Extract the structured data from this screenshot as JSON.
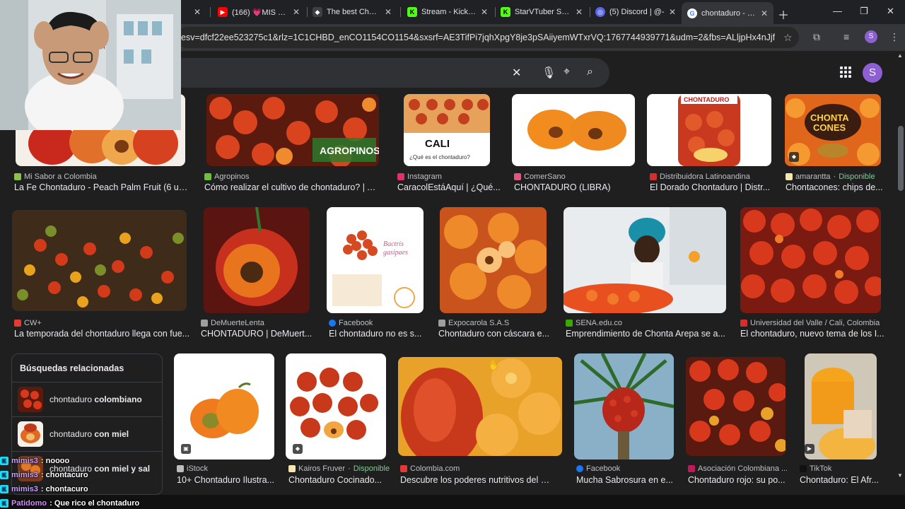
{
  "browser": {
    "tabs": [
      {
        "title": "e",
        "favicon": "tab-favicon",
        "color": "#5f6368"
      },
      {
        "title": "(166) 💗MIS PAPÁ...",
        "favicon": "youtube-icon",
        "color": "#ff0000"
      },
      {
        "title": "The best ChatBo",
        "favicon": "chatbot-icon",
        "color": "#e8eaed"
      },
      {
        "title": "Stream - Kick Da",
        "favicon": "kick-icon",
        "color": "#53fc18"
      },
      {
        "title": "StarVTuber Strea",
        "favicon": "kick-icon",
        "color": "#53fc18"
      },
      {
        "title": "(5) Discord | @-",
        "favicon": "discord-icon",
        "color": "#5865f2"
      },
      {
        "title": "chontaduro - Bu",
        "favicon": "google-icon",
        "color": "#ffffff"
      }
    ],
    "url": "esv=dfcf22ee523275c1&rlz=1C1CHBD_enCO1154CO1154&sxsrf=AE3TifPi7jqhXpgY8je3pSAiiyemWTxrVQ:1767744939771&udm=2&fbs=ALljpHx4nJjfGojPVHhEAC...",
    "profile_initial": "S"
  },
  "google": {
    "account_initial": "S"
  },
  "row1": [
    {
      "source": "Mi Sabor a Colombia",
      "title": "La Fe Chontaduro - Peach Palm Fruit (6 uni...",
      "fav": "#8bc34a"
    },
    {
      "source": "Agropinos",
      "title": "Cómo realizar el cultivo de chontaduro? | Ag...",
      "fav": "#6fbf3a"
    },
    {
      "source": "Instagram",
      "title": "CaracolEstáAquí | ¿Qué...",
      "fav": "#e1306c"
    },
    {
      "source": "ComerSano",
      "title": "CHONTADURO (LIBRA)",
      "fav": "#e05780"
    },
    {
      "source": "Distribuidora Latinoandina",
      "title": "El Dorado Chontaduro | Distr...",
      "fav": "#d32f2f"
    },
    {
      "source": "amarantta",
      "available": "Disponible",
      "title": "Chontacones: chips de...",
      "fav": "#f5e6b0"
    }
  ],
  "row2": [
    {
      "source": "CW+",
      "title": "La temporada del chontaduro llega con fue...",
      "fav": "#e53935"
    },
    {
      "source": "DeMuerteLenta",
      "title": "CHONTADURO | DeMuert...",
      "fav": "#9e9e9e"
    },
    {
      "source": "Facebook",
      "title": "El chontaduro no es s...",
      "fav": "#1877f2"
    },
    {
      "source": "Expocarola S.A.S",
      "title": "Chontaduro con cáscara e...",
      "fav": "#9e9e9e"
    },
    {
      "source": "SENA.edu.co",
      "title": "Emprendimiento de Chonta Arepa se a...",
      "fav": "#39a900"
    },
    {
      "source": "Universidad del Valle / Cali, Colombia",
      "title": "El chontaduro, nuevo tema de los I...",
      "fav": "#d32f2f"
    }
  ],
  "row3": [
    {
      "source": "iStock",
      "title": "10+ Chontaduro Ilustra...",
      "fav": "#bdbdbd"
    },
    {
      "source": "Kairos Fruver",
      "available": "Disponible",
      "title": "Chontaduro Cocinado...",
      "fav": "#f5e6b0"
    },
    {
      "source": "Colombia.com",
      "title": "Descubre los poderes nutritivos del Cho...",
      "fav": "#e53935"
    },
    {
      "source": "Facebook",
      "title": "Mucha Sabrosura en e...",
      "fav": "#1877f2"
    },
    {
      "source": "Asociación Colombiana ...",
      "title": "Chontaduro rojo: su po...",
      "fav": "#c2185b"
    },
    {
      "source": "TikTok",
      "title": "Chontaduro: El Afr...",
      "fav": "#111111"
    }
  ],
  "related": {
    "title": "Búsquedas relacionadas",
    "items": [
      {
        "prefix": "chontaduro ",
        "bold": "colombiano"
      },
      {
        "prefix": "chontaduro ",
        "bold": "con miel"
      },
      {
        "prefix": "chontaduro ",
        "bold": "con miel y sal"
      }
    ]
  },
  "chat": [
    {
      "user": "mimis3",
      "message": ": noooo"
    },
    {
      "user": "mimis3",
      "message": ": chontacuro"
    },
    {
      "user": "mimis3",
      "message": ": chontacuro"
    },
    {
      "user": "Patidomo",
      "message": ": Que rico el chontaduro"
    }
  ]
}
